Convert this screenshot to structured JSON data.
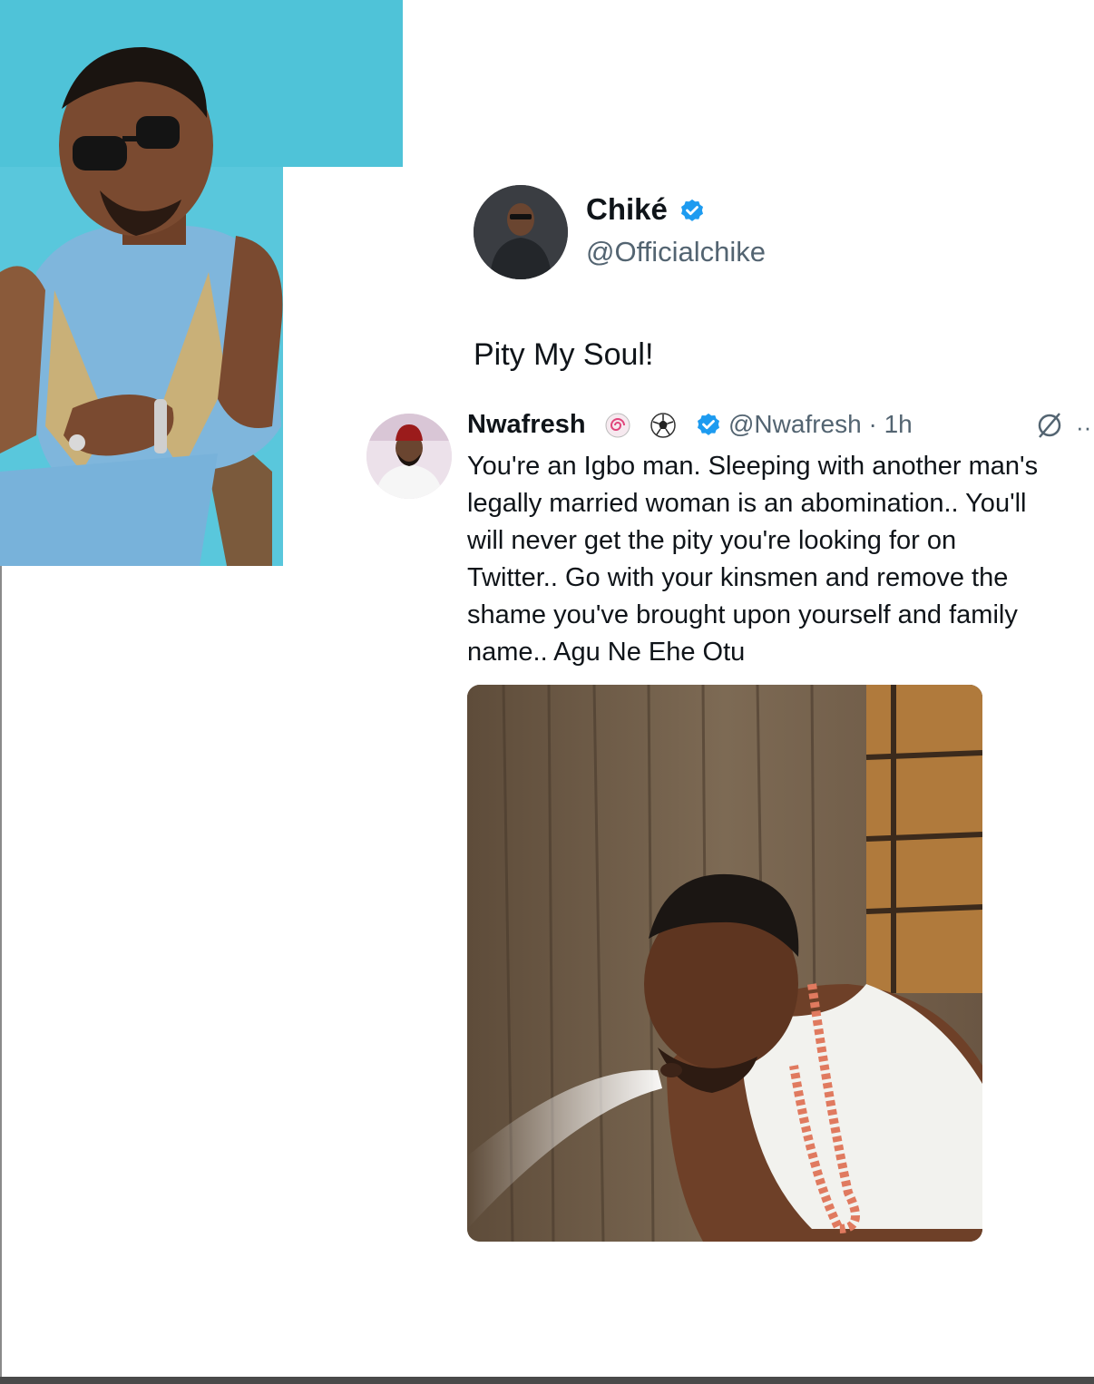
{
  "tweet": {
    "display_name": "Chiké",
    "handle": "@Officialchike",
    "text": "Pity My Soul!"
  },
  "reply": {
    "display_name": "Nwafresh",
    "handle_time": "@Nwafresh · 1h",
    "lines": [
      "You're an Igbo man. Sleeping with another man's",
      "legally married woman is an abomination.. You'll",
      "will never get the pity you're looking for on",
      "Twitter.. Go with your kinsmen and remove the",
      "shame you've brought upon yourself and family",
      "name.. Agu Ne Ehe Otu"
    ]
  },
  "icons": {
    "verified": "verified-badge-icon",
    "grok": "grok-icon",
    "more": "more-icon",
    "emoji_1": "spiral-emoji-icon",
    "emoji_2": "soccer-ball-emoji-icon"
  },
  "colors": {
    "verified_blue": "#1d9bf0",
    "secondary_text": "#536471",
    "photo_background": "#4fc3d8"
  }
}
